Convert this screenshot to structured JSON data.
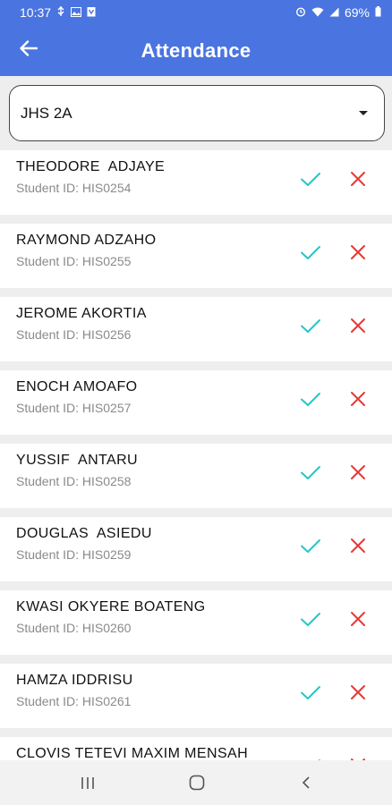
{
  "status_bar": {
    "time": "10:37",
    "battery": "69%",
    "left_icons": [
      "usb-icon",
      "image-icon",
      "clipboard-icon"
    ],
    "right_icons": [
      "alarm-icon",
      "wifi-icon",
      "signal-icon",
      "battery-icon"
    ]
  },
  "app_bar": {
    "title": "Attendance",
    "back_icon": "arrow-left-icon",
    "color": "#4a74e0"
  },
  "class_select": {
    "value": "JHS 2A",
    "icon": "dropdown-arrow-icon"
  },
  "students": [
    {
      "name": "THEODORE  ADJAYE",
      "id": "Student ID: HIS0254"
    },
    {
      "name": "RAYMOND ADZAHO",
      "id": "Student ID: HIS0255"
    },
    {
      "name": "JEROME AKORTIA",
      "id": "Student ID: HIS0256"
    },
    {
      "name": "ENOCH AMOAFO",
      "id": "Student ID: HIS0257"
    },
    {
      "name": "YUSSIF  ANTARU",
      "id": "Student ID: HIS0258"
    },
    {
      "name": "DOUGLAS  ASIEDU",
      "id": "Student ID: HIS0259"
    },
    {
      "name": "KWASI OKYERE BOATENG",
      "id": "Student ID: HIS0260"
    },
    {
      "name": "HAMZA IDDRISU",
      "id": "Student ID: HIS0261"
    },
    {
      "name": "CLOVIS TETEVI MAXIM MENSAH",
      "id": ""
    }
  ],
  "colors": {
    "present": "#26c6c6",
    "absent": "#e53935"
  },
  "nav_bar": {
    "icons": [
      "recent-apps-icon",
      "home-icon",
      "back-icon"
    ]
  }
}
